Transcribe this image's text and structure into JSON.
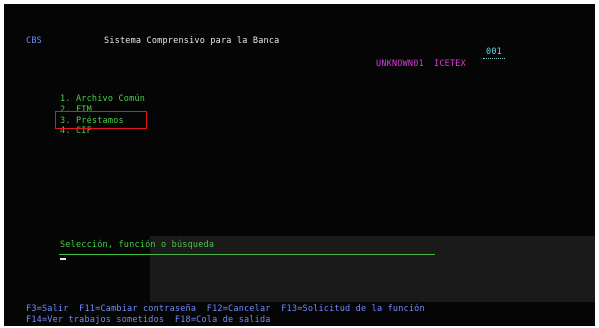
{
  "header": {
    "system_id": "CBS",
    "title": "Sistema Comprensivo para la Banca",
    "session_number": "001",
    "user": "UNKNOWN01",
    "terminal": "ICETEX"
  },
  "menu": {
    "items": [
      {
        "label": "1. Archivo Común"
      },
      {
        "label": "2. FTM"
      },
      {
        "label": "3. Préstamos"
      },
      {
        "label": "4. CIF"
      }
    ]
  },
  "command": {
    "prompt": "Selección, función o búsqueda",
    "value": ""
  },
  "function_keys": {
    "line1": "F3=Salir  F11=Cambiar contraseña  F12=Cancelar  F13=Solicitud de la función",
    "line2": "F14=Ver trabajos sometidos  F18=Cola de salida"
  },
  "colors": {
    "background": "#050505",
    "header_id": "#6f8cff",
    "title": "#e8e8e8",
    "user_info": "#d83bd8",
    "menu": "#45d145",
    "function_keys": "#6f8cff",
    "selection_box": "#e01818"
  }
}
